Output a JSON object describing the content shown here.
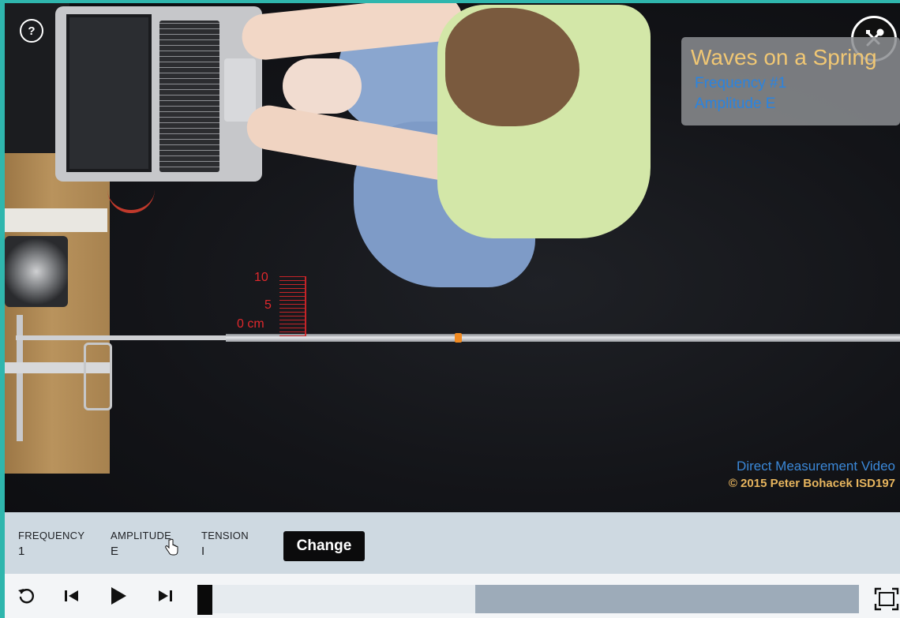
{
  "help": {
    "label": "?"
  },
  "overlay": {
    "title": "Waves on a Spring",
    "line1": "Frequency #1",
    "line2": "Amplitude E"
  },
  "ruler": {
    "label_10": "10",
    "label_5": "5",
    "label_0": "0 cm"
  },
  "credits": {
    "line1": "Direct Measurement Video",
    "line2": "© 2015 Peter Bohacek ISD197"
  },
  "controls": {
    "frequency_label": "FREQUENCY",
    "frequency_value": "1",
    "amplitude_label": "AMPLITUDE",
    "amplitude_value": "E",
    "tension_label": "TENSION",
    "tension_value": "I",
    "change_label": "Change"
  },
  "playback": {
    "position_fraction": 0.0,
    "loaded_start_fraction": 0.42
  }
}
